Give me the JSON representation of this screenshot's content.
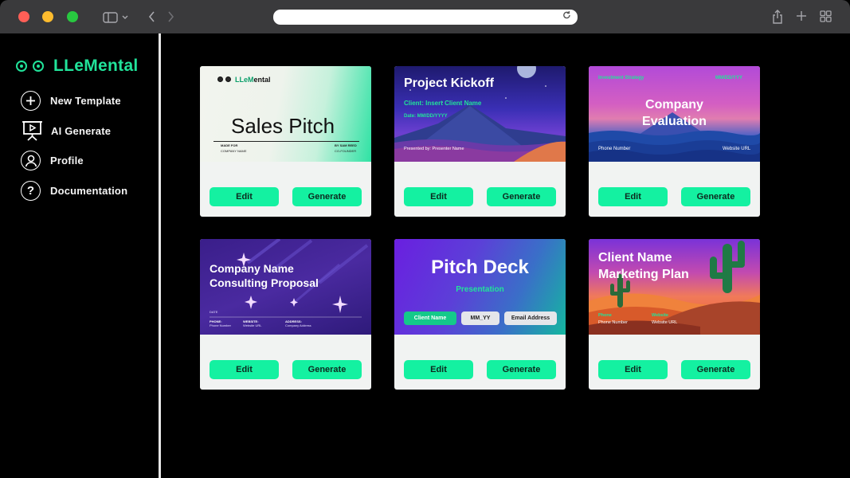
{
  "app": {
    "brand_prefix": "LLe",
    "brand_m": "M",
    "brand_suffix": "ental",
    "accent": "#14f1a1"
  },
  "sidebar": {
    "items": [
      {
        "label": "New Template",
        "icon": "plus-circle-icon"
      },
      {
        "label": "AI Generate",
        "icon": "presentation-icon"
      },
      {
        "label": "Profile",
        "icon": "user-icon"
      },
      {
        "label": "Documentation",
        "icon": "question-icon"
      }
    ]
  },
  "buttons": {
    "edit": "Edit",
    "generate": "Generate"
  },
  "templates": [
    {
      "title": "Sales Pitch",
      "brand_prefix": "LLe",
      "brand_m": "M",
      "brand_suffix": "ental",
      "made_for": "MADE FOR",
      "company": "COMPANY NAME",
      "by": "BY SAM REED",
      "cofounder": "CO-FOUNDER"
    },
    {
      "title": "Project Kickoff",
      "client": "Client: Insert Client Name",
      "date": "Date: MM/DD/YYYY",
      "presented": "Presented by: Presenter Name"
    },
    {
      "strategy": "Investment Strategy",
      "date": "MM/DD/YYY",
      "title_1": "Company",
      "title_2": "Evaluation",
      "phone": "Phone Number",
      "website": "Website URL"
    },
    {
      "title_1": "Company Name",
      "title_2": "Consulting Proposal",
      "date": "DATE",
      "phone_label": "PHONE:",
      "phone": "Phone Number",
      "website_label": "WEBSITE:",
      "website": "Website URL",
      "address_label": "ADDRESS:",
      "address": "Company Address"
    },
    {
      "title": "Pitch Deck",
      "subtitle": "Presentation",
      "chip_1": "Client Name",
      "chip_2": "MM_YY",
      "chip_3": "Email Address"
    },
    {
      "title_1": "Client Name",
      "title_2": "Marketing Plan",
      "phone_label": "Phone",
      "phone": "Phone Number",
      "website_label": "Website",
      "website": "Website URL"
    }
  ]
}
